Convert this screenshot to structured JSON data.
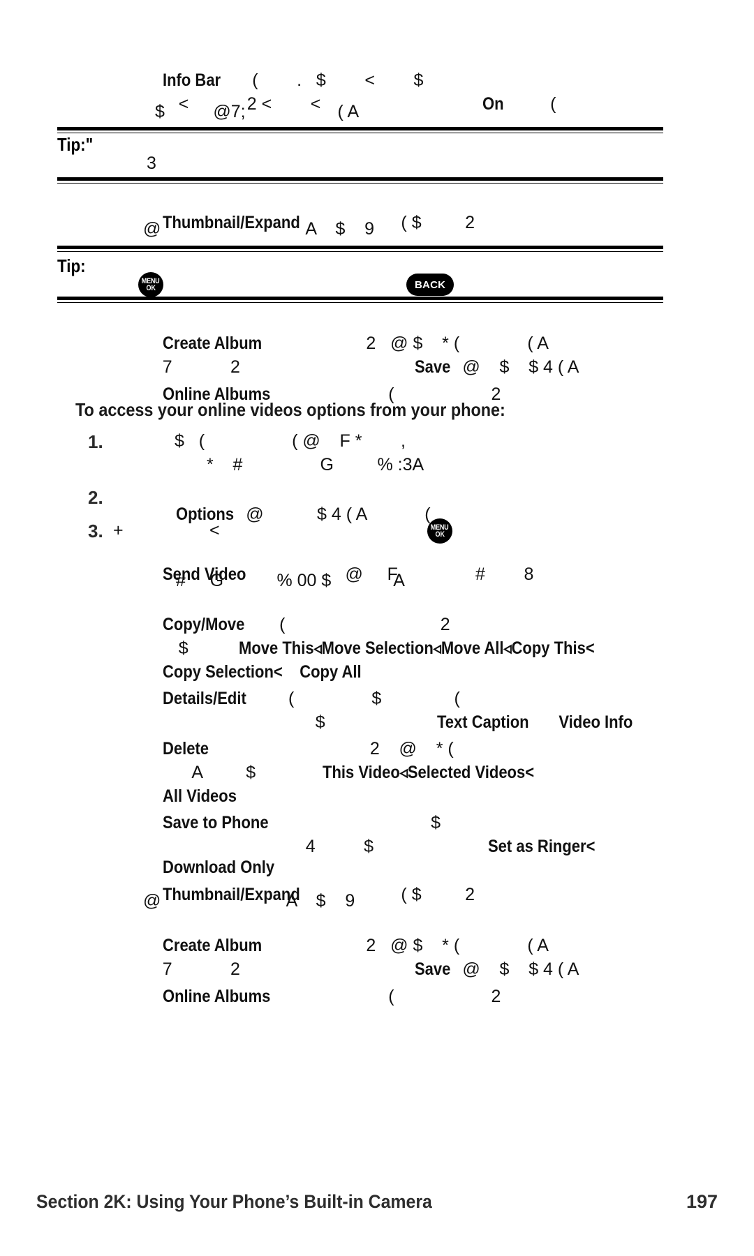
{
  "document": {
    "footer_section": "Section 2K: Using Your Phone’s Built-in Camera",
    "page_number": "197"
  },
  "keys": {
    "menu_ok_line1": "MENU",
    "menu_ok_line2": "OK",
    "back": "BACK"
  },
  "labels": {
    "tip1": "Tip:\"",
    "tip2": "Tip:"
  },
  "intro": {
    "online_videos": "To access your online videos options from your phone:"
  },
  "steps": {
    "one": "1.",
    "two": "2.",
    "three": "3."
  },
  "blocks": {
    "info_bar": {
      "term": "Info Bar",
      "line1_rest": "(        .   $        <        $",
      "line2": "<            2 <        <",
      "line2_term": "On",
      "line2_tail": "(",
      "line3": "$          @7;                   ( A"
    },
    "tip1_body": "3",
    "thumbnail_expand_top": {
      "term": "Thumbnail/Expand",
      "line1_rest": "( $         2",
      "line2": "@                              A    $    9"
    },
    "create_album_top": {
      "term": "Create Album",
      "line1_rest": "2   @ $    * (              ( A",
      "line2_lead": "7            2",
      "line2_term": "Save",
      "line2_rest": "@    $    $ 4 ( A"
    },
    "online_albums_top": {
      "term": "Online Albums",
      "rest": "(                    2"
    },
    "step1": {
      "line1": "$   (                  ( @    F *        ,",
      "line2": "*    #                G         % :3A"
    },
    "step2": {
      "term": "Options",
      "rest": "@           $ 4 ( A            ("
    },
    "step3": {
      "lead": "+",
      "mid": "<"
    },
    "send_video": {
      "term": "Send Video",
      "line1_rest": "@     F                #        8",
      "line2": "#     G           % 00 $             A"
    },
    "copy_move": {
      "term": "Copy/Move",
      "line1_rest": "(                                2",
      "line2_lead": "$",
      "line2_terms": "Move This◃Move Selection◃Move All◃Copy This<",
      "line3_terms": "Copy Selection<    Copy All"
    },
    "details_edit": {
      "term": "Details/Edit",
      "line1_rest": "(                $               (",
      "line2_lead": "$",
      "line2_terms": "Text Caption       Video Info"
    },
    "delete": {
      "term": "Delete",
      "line1_rest": "2    @    * (",
      "line2_lead": "A         $",
      "line2_terms": "This Video◃Selected Videos<",
      "line3_terms": "All Videos"
    },
    "save_to_phone": {
      "term": "Save to Phone",
      "line1_rest": "$",
      "line2_lead": "4          $",
      "line2_terms": "Set as Ringer<"
    },
    "download_only": {
      "term": "Download Only"
    },
    "thumbnail_expand_bottom": {
      "term": "Thumbnail/Expand",
      "line1_rest": "( $         2",
      "line2": "@                          A    $    9"
    },
    "create_album_bottom": {
      "term": "Create Album",
      "line1_rest": "2   @ $    * (              ( A",
      "line2_lead": "7            2",
      "line2_term": "Save",
      "line2_rest": "@    $    $ 4 ( A"
    },
    "online_albums_bottom": {
      "term": "Online Albums",
      "rest": "(                    2"
    }
  }
}
